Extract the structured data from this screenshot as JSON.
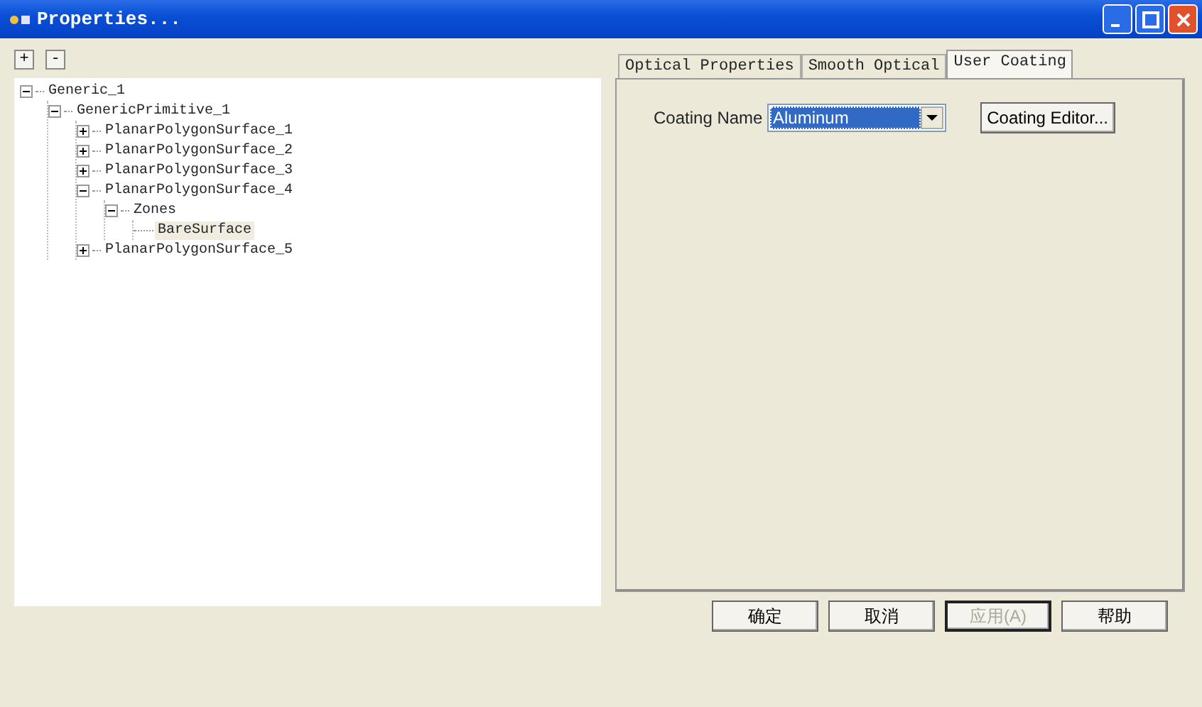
{
  "window": {
    "title": "Properties..."
  },
  "tree_buttons": [
    {
      "label": "+"
    },
    {
      "label": "-"
    }
  ],
  "tree": [
    {
      "label": "Generic_1",
      "expanded": true,
      "selected": false,
      "children": [
        {
          "label": "GenericPrimitive_1",
          "expanded": true,
          "selected": false,
          "children": [
            {
              "label": "PlanarPolygonSurface_1",
              "expanded": false,
              "selected": false,
              "has_children": true
            },
            {
              "label": "PlanarPolygonSurface_2",
              "expanded": false,
              "selected": false,
              "has_children": true
            },
            {
              "label": "PlanarPolygonSurface_3",
              "expanded": false,
              "selected": false,
              "has_children": true
            },
            {
              "label": "PlanarPolygonSurface_4",
              "expanded": true,
              "selected": false,
              "children": [
                {
                  "label": "Zones",
                  "expanded": true,
                  "selected": false,
                  "children": [
                    {
                      "label": "BareSurface",
                      "selected": true
                    }
                  ]
                }
              ]
            },
            {
              "label": "PlanarPolygonSurface_5",
              "expanded": false,
              "selected": false,
              "has_children": true
            }
          ]
        }
      ]
    }
  ],
  "tabs": [
    {
      "label": "Optical Properties",
      "selected": false
    },
    {
      "label": "Smooth Optical",
      "selected": false
    },
    {
      "label": "User Coating",
      "selected": true
    }
  ],
  "coating": {
    "label": "Coating Name",
    "value": "Aluminum",
    "editor_button": "Coating Editor..."
  },
  "buttons": [
    {
      "label": "确定",
      "disabled": false
    },
    {
      "label": "取消",
      "disabled": false
    },
    {
      "label": "应用(A)",
      "disabled": true
    },
    {
      "label": "帮助",
      "disabled": false
    }
  ]
}
